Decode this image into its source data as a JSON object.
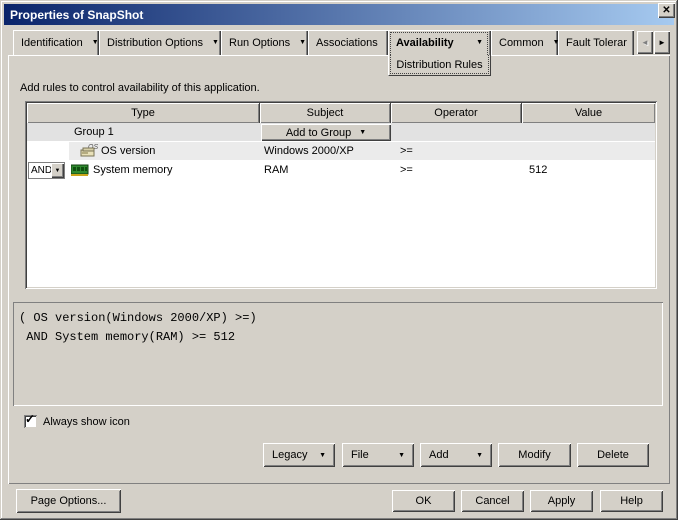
{
  "window": {
    "title": "Properties of SnapShot"
  },
  "icons": {
    "close": "✕",
    "dropdown": "▼",
    "combo_arrow": "▼",
    "scroll_left": "◄",
    "scroll_right": "►",
    "check": "✓"
  },
  "colors": {
    "titlebar_gradient_start": "#0a246a",
    "titlebar_gradient_end": "#a6caf0",
    "dialog_bg": "#d4d0c8",
    "list_bg": "#ffffff",
    "row_gray": "#e2e2e2",
    "row_shaded": "#ebebeb"
  },
  "tabs": [
    {
      "label": "Identification",
      "dropdown": true,
      "selected": false
    },
    {
      "label": "Distribution Options",
      "dropdown": true,
      "selected": false
    },
    {
      "label": "Run Options",
      "dropdown": true,
      "selected": false
    },
    {
      "label": "Associations",
      "dropdown": false,
      "selected": false
    },
    {
      "label": "Availability",
      "dropdown": true,
      "selected": true,
      "sub_label": "Distribution Rules"
    },
    {
      "label": "Common",
      "dropdown": true,
      "selected": false
    },
    {
      "label": "Fault Tolerar",
      "dropdown": false,
      "selected": false,
      "clipped": true
    }
  ],
  "page": {
    "instruction": "Add rules to control availability of this application.",
    "rules_table": {
      "columns": [
        "Type",
        "Subject",
        "Operator",
        "Value"
      ],
      "rows": [
        {
          "kind": "group",
          "type": "Group 1",
          "subject_button": "Add to Group",
          "operator": "",
          "value": ""
        },
        {
          "kind": "rule",
          "icon": "os-version-icon",
          "type": "OS version",
          "subject": "Windows 2000/XP",
          "operator": ">=",
          "value": ""
        },
        {
          "kind": "rule",
          "conjunction": "AND",
          "icon": "system-memory-icon",
          "type": "System memory",
          "subject": "RAM",
          "operator": ">=",
          "value": "512"
        }
      ]
    },
    "expression": {
      "lines": [
        "( OS version(Windows 2000/XP) >=)",
        " AND System memory(RAM) >= 512"
      ]
    },
    "always_show_icon": {
      "label": "Always show icon",
      "checked": true
    },
    "buttons": {
      "legacy": "Legacy",
      "file": "File",
      "add": "Add",
      "modify": "Modify",
      "delete": "Delete"
    }
  },
  "footer": {
    "page_options": "Page Options...",
    "ok": "OK",
    "cancel": "Cancel",
    "apply": "Apply",
    "help": "Help"
  }
}
